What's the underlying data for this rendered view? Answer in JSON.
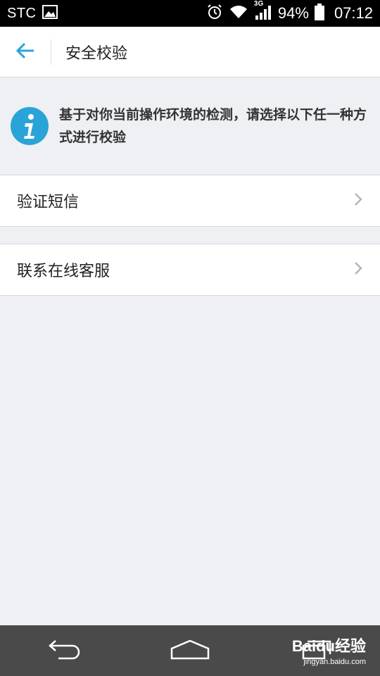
{
  "status_bar": {
    "carrier": "STC",
    "network": "3G",
    "battery": "94%",
    "time": "07:12"
  },
  "header": {
    "back_icon": "back-arrow-icon",
    "title": "安全校验"
  },
  "notice": {
    "icon": "info-icon",
    "text": "基于对你当前操作环境的检测，请选择以下任一种方式进行校验"
  },
  "menu": [
    {
      "label": "验证短信"
    },
    {
      "label": "联系在线客服"
    }
  ],
  "colors": {
    "accent": "#2aa4d8",
    "background": "#eef0f3",
    "nav_bar": "#4a4a4a"
  },
  "watermark": {
    "brand": "Baidu经验",
    "url": "jingyan.baidu.com"
  }
}
